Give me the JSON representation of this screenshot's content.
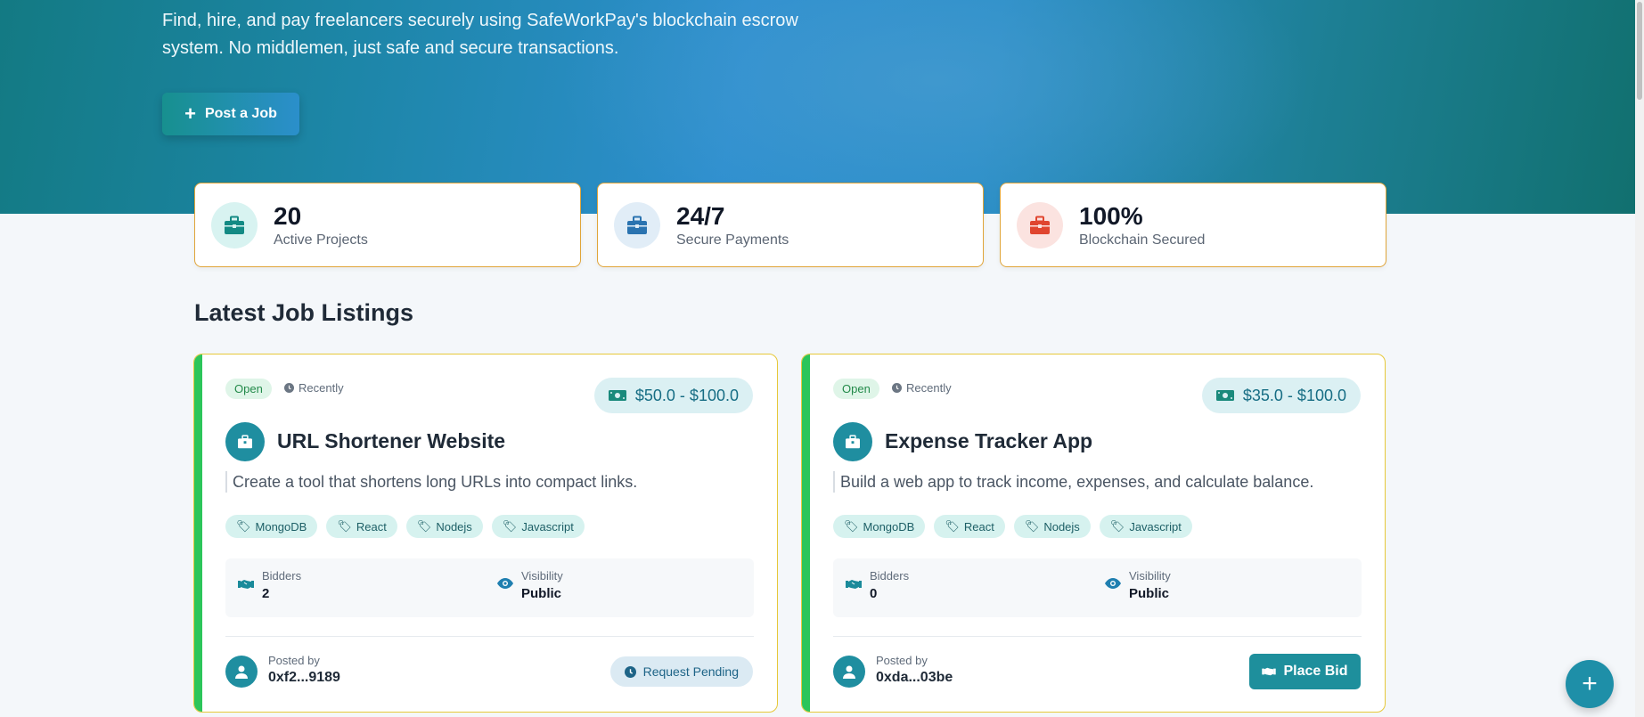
{
  "hero": {
    "description": "Find, hire, and pay freelancers securely using SafeWorkPay's blockchain escrow system. No middlemen, just safe and secure transactions.",
    "post_job_label": "Post a Job"
  },
  "stats": [
    {
      "value": "20",
      "label": "Active Projects",
      "color": "#138a84",
      "bg": "#d8f3f1"
    },
    {
      "value": "24/7",
      "label": "Secure Payments",
      "color": "#2a73b0",
      "bg": "#e1edf7"
    },
    {
      "value": "100%",
      "label": "Blockchain Secured",
      "color": "#e0452f",
      "bg": "#fbe3e0"
    }
  ],
  "section_title": "Latest Job Listings",
  "jobs": [
    {
      "status": "Open",
      "time": "Recently",
      "price": "$50.0 - $100.0",
      "title": "URL Shortener Website",
      "description": "Create a tool that shortens long URLs into compact links.",
      "tags": [
        "MongoDB",
        "React",
        "Nodejs",
        "Javascript"
      ],
      "bidders_label": "Bidders",
      "bidders": "2",
      "visibility_label": "Visibility",
      "visibility": "Public",
      "posted_by_label": "Posted by",
      "posted_by": "0xf2...9189",
      "action_label": "Request Pending"
    },
    {
      "status": "Open",
      "time": "Recently",
      "price": "$35.0 - $100.0",
      "title": "Expense Tracker App",
      "description": "Build a web app to track income, expenses, and calculate balance.",
      "tags": [
        "MongoDB",
        "React",
        "Nodejs",
        "Javascript"
      ],
      "bidders_label": "Bidders",
      "bidders": "0",
      "visibility_label": "Visibility",
      "visibility": "Public",
      "posted_by_label": "Posted by",
      "posted_by": "0xda...03be",
      "action_label": "Place Bid"
    }
  ],
  "fab_icon": "plus-icon"
}
